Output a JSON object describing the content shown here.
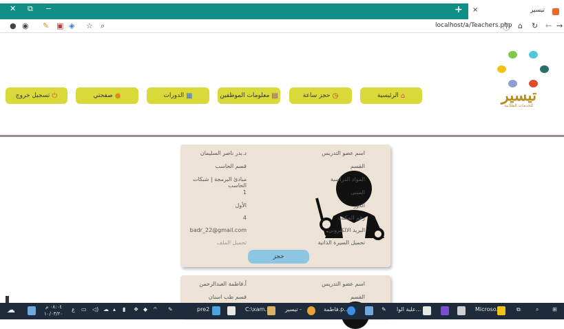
{
  "browser": {
    "tab_title": "تيسير",
    "url": "localhost/a/Teachers.php",
    "window_close": "✕",
    "window_restore": "⧉",
    "window_min": "−",
    "new_tab": "+",
    "tab_close": "×"
  },
  "logo": {
    "name": "تيسير",
    "tagline": "للخدمات الطلابية",
    "dot_colors": [
      "#7fc94a",
      "#53c6de",
      "#2a6f6b",
      "#e04a2a",
      "#8f9fd6",
      "#f2c318"
    ]
  },
  "nav": {
    "home": "الرئيسية",
    "book_hour": "حجز ساعة",
    "staff_info": "معلومات الموظفين",
    "courses": "الدورات",
    "my_page": "صفحتي",
    "logout": "تسجيل خروج"
  },
  "labels": {
    "name": "اسم عضو التدريس",
    "department": "القسم",
    "subjects": "المواد الدراسية",
    "building": "المبنى",
    "floor": "الدور",
    "office": "رقم المكتب",
    "email": "البريد الالكتروني",
    "cv": "تحميل السيرة الذاتية"
  },
  "teachers": [
    {
      "name": "د.بدر ناصر السليمان",
      "department": "قسم الحاسب",
      "subjects": "مبادئ البرمجة | شبكات الحاسب",
      "building": "1",
      "floor": "الأول",
      "office": "4",
      "email": "badr_22@gmail.com",
      "cv_link": "تحميل الملف",
      "book_label": "حجز"
    },
    {
      "name": "أ.فاطمة العبدالرحمن",
      "department": "قسم طب اسنان"
    }
  ],
  "taskbar": {
    "time": "٠٨:٠٤ م",
    "date": "١٠/٠٣/٢٠",
    "items": [
      "pre2",
      "C:\\xam...",
      "تيسير -",
      "فاطمة.p...",
      "علبة الوا...",
      "Microso..."
    ]
  }
}
